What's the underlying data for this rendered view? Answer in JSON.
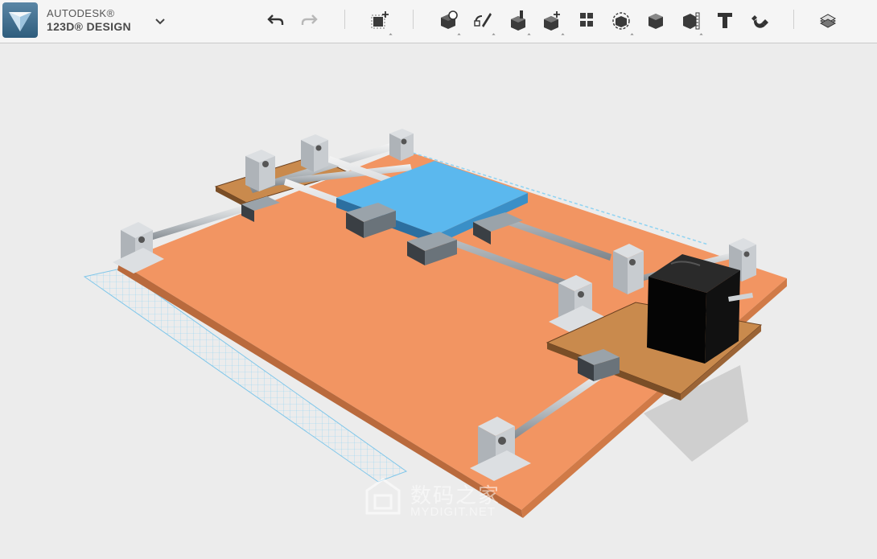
{
  "app": {
    "brand_line1": "AUTODESK®",
    "brand_line2": "123D® DESIGN"
  },
  "toolbar": {
    "tools": [
      {
        "id": "undo",
        "icon": "undo-icon"
      },
      {
        "id": "redo",
        "icon": "redo-icon"
      },
      {
        "id": "transform",
        "icon": "transform-icon"
      },
      {
        "id": "primitives",
        "icon": "primitives-icon"
      },
      {
        "id": "sketch",
        "icon": "sketch-icon"
      },
      {
        "id": "construct",
        "icon": "construct-icon"
      },
      {
        "id": "modify",
        "icon": "modify-icon"
      },
      {
        "id": "pattern",
        "icon": "pattern-icon"
      },
      {
        "id": "grouping",
        "icon": "grouping-icon"
      },
      {
        "id": "combine",
        "icon": "combine-icon"
      },
      {
        "id": "measure",
        "icon": "measure-icon"
      },
      {
        "id": "text",
        "icon": "text-icon"
      },
      {
        "id": "snap",
        "icon": "snap-magnet-icon"
      },
      {
        "id": "material",
        "icon": "material-icon"
      }
    ]
  },
  "colors": {
    "base_plate": "#f29562",
    "top_plate": "#5bb8ee",
    "side_plate": "#c98a4d",
    "motor": "#0a0a0a",
    "ruler": "#8fd3f2"
  },
  "watermark": {
    "cn": "数码之家",
    "en": "MYDIGIT.NET"
  }
}
